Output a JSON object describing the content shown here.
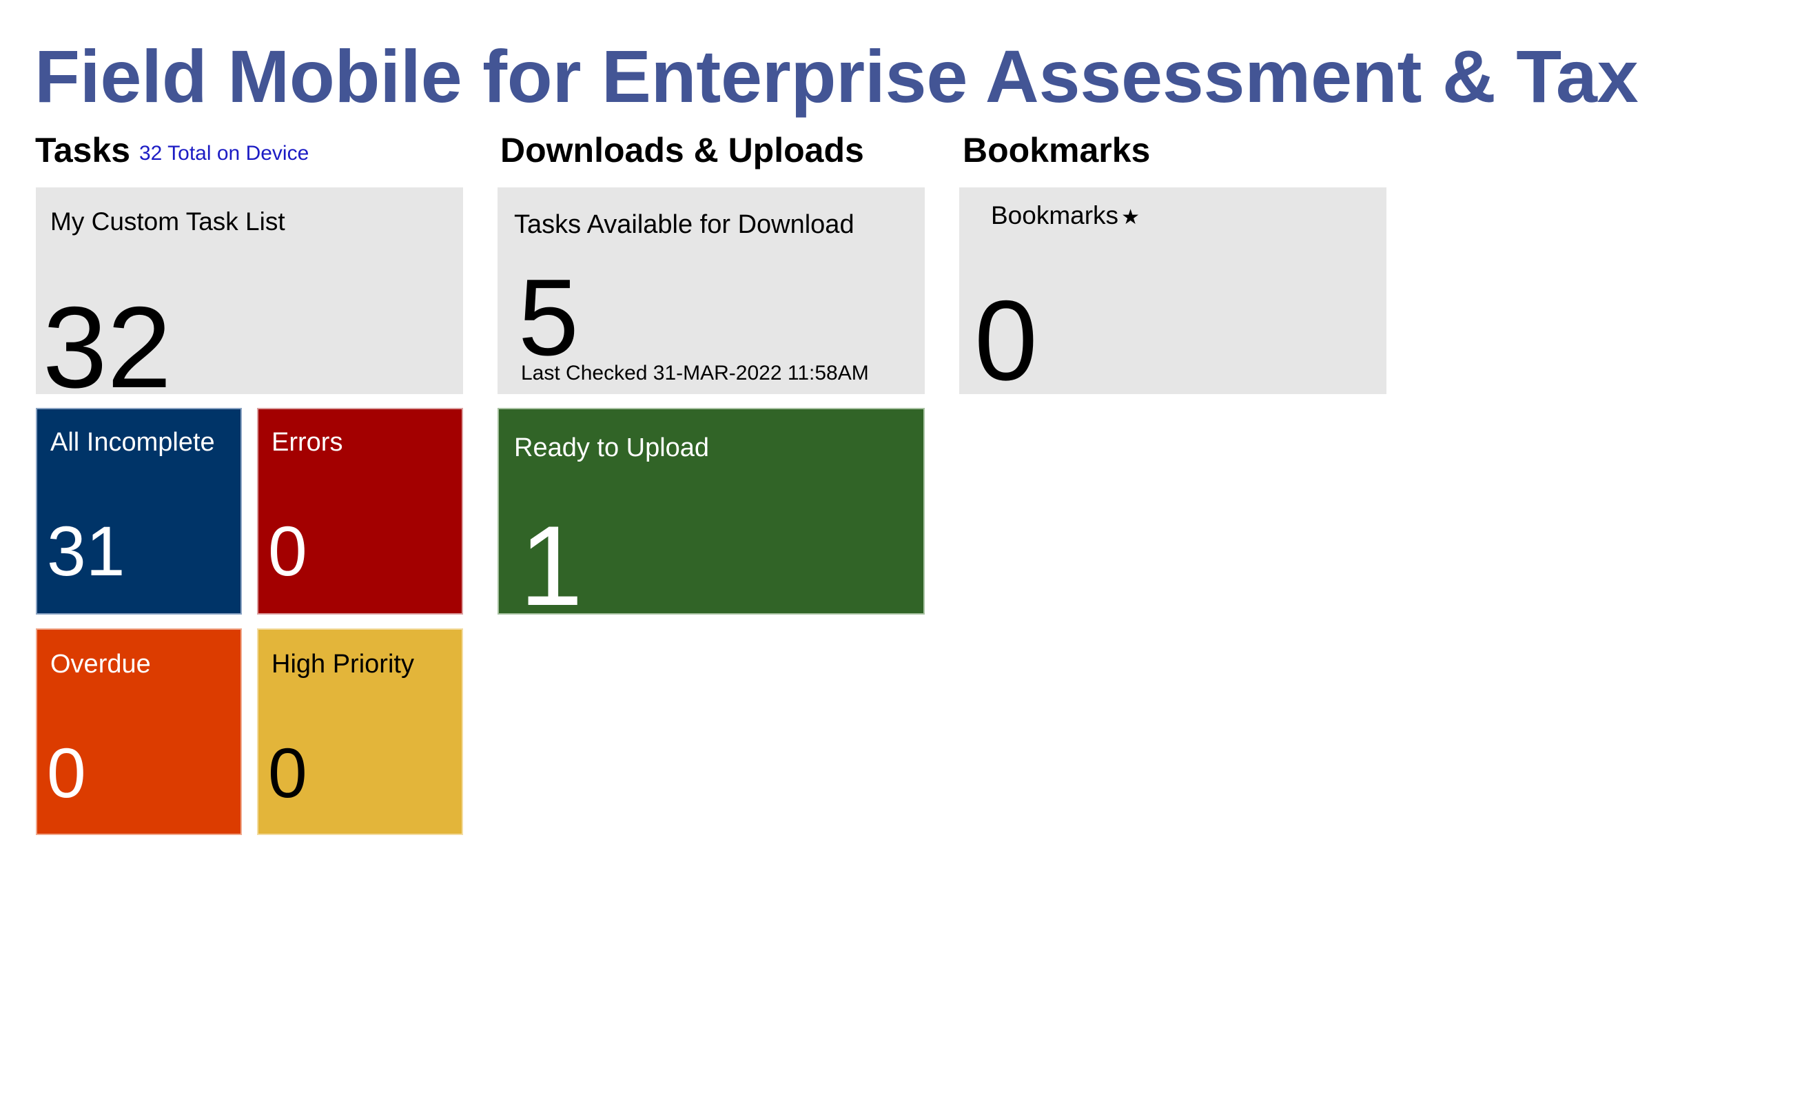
{
  "app": {
    "title": "Field Mobile for Enterprise Assessment & Tax"
  },
  "sections": {
    "tasks": {
      "heading": "Tasks",
      "subtitle": "32 Total on Device",
      "custom_list": {
        "label": "My Custom Task List",
        "count": "32"
      },
      "all_incomplete": {
        "label": "All Incomplete",
        "count": "31",
        "color": "#003468"
      },
      "errors": {
        "label": "Errors",
        "count": "0",
        "color": "#a30000"
      },
      "overdue": {
        "label": "Overdue",
        "count": "0",
        "color": "#dc3c00"
      },
      "high_priority": {
        "label": "High Priority",
        "count": "0",
        "color": "#e3b53a"
      }
    },
    "transfers": {
      "heading": "Downloads & Uploads",
      "available": {
        "label": "Tasks Available for Download",
        "count": "5",
        "last_checked": "Last Checked 31-MAR-2022 11:58AM"
      },
      "ready_upload": {
        "label": "Ready to Upload",
        "count": "1",
        "color": "#316427"
      }
    },
    "bookmarks": {
      "heading": "Bookmarks",
      "tile": {
        "label": "Bookmarks",
        "icon": "star-icon",
        "icon_glyph": "★",
        "count": "0"
      }
    }
  },
  "colors": {
    "title": "#435595",
    "subtitle": "#1c1cc4",
    "tile_neutral": "#e6e6e6"
  }
}
